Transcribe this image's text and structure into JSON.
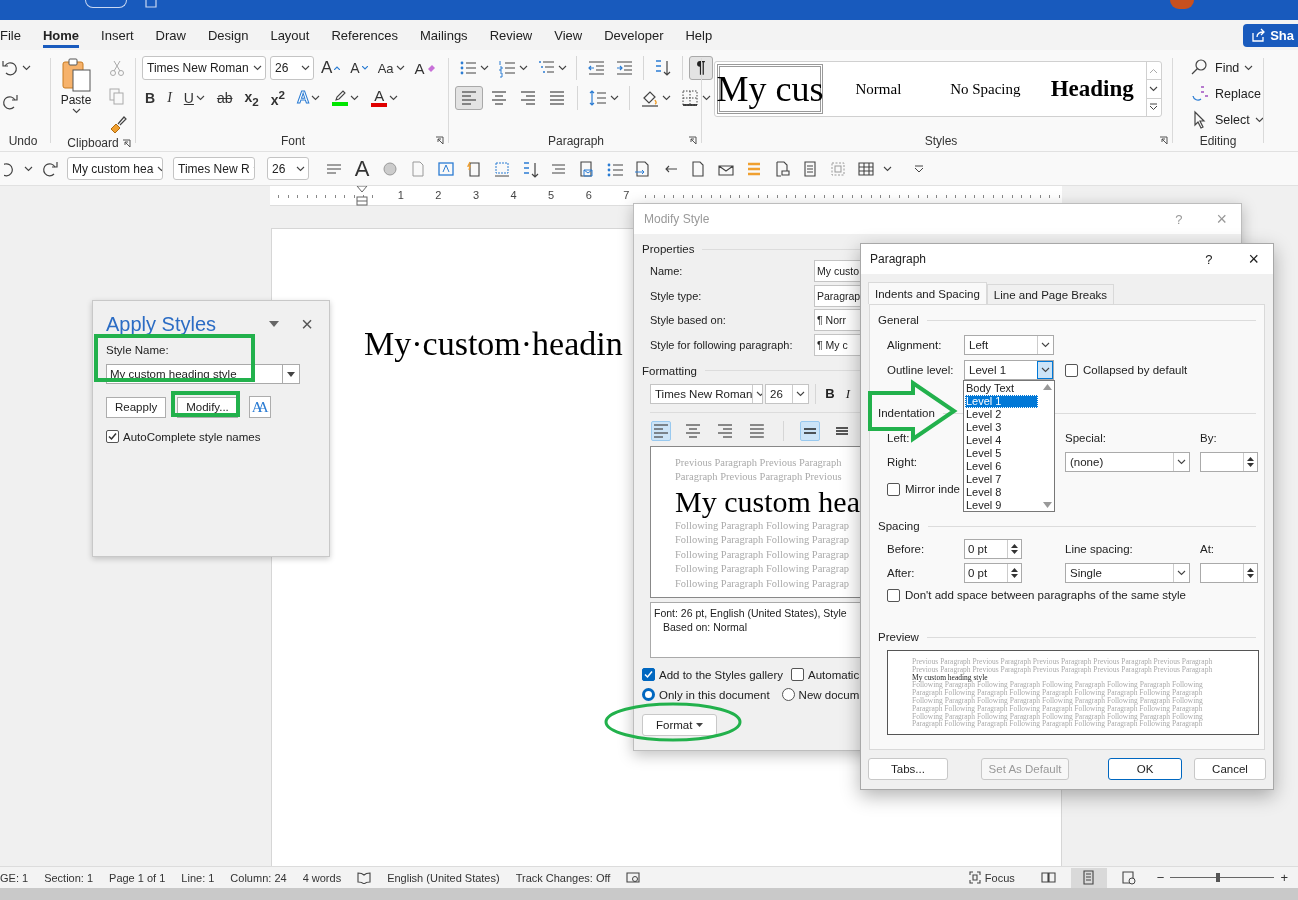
{
  "ribbon_tabs": [
    {
      "label": "File",
      "selected": false
    },
    {
      "label": "Home",
      "selected": true
    },
    {
      "label": "Insert",
      "selected": false
    },
    {
      "label": "Draw",
      "selected": false
    },
    {
      "label": "Design",
      "selected": false
    },
    {
      "label": "Layout",
      "selected": false
    },
    {
      "label": "References",
      "selected": false
    },
    {
      "label": "Mailings",
      "selected": false
    },
    {
      "label": "Review",
      "selected": false
    },
    {
      "label": "View",
      "selected": false
    },
    {
      "label": "Developer",
      "selected": false
    },
    {
      "label": "Help",
      "selected": false
    }
  ],
  "share_button": "Sha",
  "undo_group": {
    "label": "Undo"
  },
  "clipboard_group": {
    "label": "Clipboard",
    "paste": "Paste"
  },
  "font_group": {
    "label": "Font",
    "font": "Times New Roman",
    "size": "26",
    "row1": [
      {
        "kind": "grow",
        "glyph": "A"
      },
      {
        "kind": "shrink",
        "glyph": "A"
      },
      {
        "kind": "case",
        "glyph": "Aa"
      },
      {
        "kind": "clear",
        "glyph": "A"
      }
    ],
    "row2": [
      {
        "kind": "bold",
        "glyph": "B"
      },
      {
        "kind": "italic",
        "glyph": "I"
      },
      {
        "kind": "underline",
        "glyph": "U"
      },
      {
        "kind": "strike",
        "glyph": "ab"
      },
      {
        "kind": "subscript",
        "glyph": "x$_{2}$"
      },
      {
        "kind": "superscript",
        "glyph": "x$^{2}$"
      },
      {
        "kind": "effects",
        "glyph": "A"
      },
      {
        "kind": "highlight",
        "color": "#00e600"
      },
      {
        "kind": "font_color",
        "glyph": "A",
        "color": "#e00000"
      }
    ]
  },
  "paragraph_group": {
    "label": "Paragraph",
    "show_marks": {
      "glyph": "¶",
      "on": true
    },
    "alignment": [
      {
        "kind": "left",
        "selected": true
      },
      {
        "kind": "center",
        "selected": false
      },
      {
        "kind": "right",
        "selected": false
      },
      {
        "kind": "justify",
        "selected": false
      }
    ]
  },
  "styles_group": {
    "label": "Styles",
    "items": [
      {
        "label": "My cus",
        "kind": "custom",
        "selected": true
      },
      {
        "label": "Normal",
        "kind": "normal",
        "selected": false
      },
      {
        "label": "No Spacing",
        "kind": "normal",
        "selected": false
      },
      {
        "label": "Heading",
        "kind": "heading",
        "selected": false
      }
    ]
  },
  "editing_group": {
    "label": "Editing",
    "items": [
      {
        "label": "Find",
        "kind": "find"
      },
      {
        "label": "Replace",
        "kind": "replace"
      },
      {
        "label": "Select",
        "kind": "select"
      }
    ]
  },
  "quick_toolbar": {
    "style": "My custom hea",
    "font": "Times New R",
    "size": "26",
    "big_glyph": "A"
  },
  "ruler": {
    "numbers": [
      "1",
      "2",
      "3",
      "4",
      "5",
      "6",
      "7"
    ]
  },
  "document": {
    "heading": "My·custom·headin"
  },
  "apply_styles": {
    "title": "Apply Styles",
    "close": "×",
    "style_name_label": "Style Name:",
    "style_name": "My custom heading style",
    "buttons": [
      "Reapply",
      "Modify..."
    ],
    "styles_glyph": "AA",
    "autocomplete": {
      "label": "AutoComplete style names",
      "checked": true
    }
  },
  "modify_style": {
    "title": "Modify Style",
    "help": "?",
    "close": "×",
    "properties_heading": "Properties",
    "fields": [
      {
        "label": "Name:",
        "value": "My custo"
      },
      {
        "label": "Style type:",
        "value": "Paragrap"
      },
      {
        "label": "Style based on:",
        "value": "¶ Norr"
      },
      {
        "label": "Style for following paragraph:",
        "value": "¶ My c"
      }
    ],
    "formatting_heading": "Formatting",
    "font": "Times New Roman",
    "size": "26",
    "text_buttons": [
      {
        "kind": "bold",
        "glyph": "B"
      },
      {
        "kind": "italic",
        "glyph": "I"
      }
    ],
    "alignment": [
      {
        "kind": "left",
        "selected": true
      },
      {
        "kind": "center",
        "selected": false
      },
      {
        "kind": "right",
        "selected": false
      },
      {
        "kind": "justify",
        "selected": false
      }
    ],
    "spacing": [
      {
        "kind": "single",
        "selected": true
      },
      {
        "kind": "one_half",
        "selected": false
      }
    ],
    "preview": {
      "previous": [
        "Previous Paragraph Previous Paragraph",
        "Paragraph Previous Paragraph Previous"
      ],
      "heading": "My custom hea",
      "following": [
        "Following Paragraph Following Paragrap",
        "Following Paragraph Following Paragrap",
        "Following Paragraph Following Paragrap",
        "Following Paragraph Following Paragrap",
        "Following Paragraph Following Paragrap"
      ]
    },
    "description": [
      "Font: 26 pt, English (United States), Style",
      "Based on: Normal"
    ],
    "add_to_gallery": {
      "label": "Add to the Styles gallery",
      "checked": true
    },
    "auto_update": {
      "label": "Automatic",
      "checked": false
    },
    "scope": [
      {
        "label": "Only in this document",
        "selected": true
      },
      {
        "label": "New docum",
        "selected": false
      }
    ],
    "format_button": "Format"
  },
  "paragraph_dialog": {
    "title": "Paragraph",
    "help": "?",
    "close": "×",
    "tabs": [
      {
        "label": "Indents and Spacing",
        "selected": true
      },
      {
        "label": "Line and Page Breaks",
        "selected": false
      }
    ],
    "general_heading": "General",
    "alignment": {
      "label": "Alignment:",
      "value": "Left"
    },
    "outline": {
      "label": "Outline level:",
      "value": "Level 1",
      "expanded": true,
      "options": [
        {
          "label": "Body Text",
          "selected": false
        },
        {
          "label": "Level 1",
          "selected": true
        },
        {
          "label": "Level 2",
          "selected": false
        },
        {
          "label": "Level 3",
          "selected": false
        },
        {
          "label": "Level 4",
          "selected": false
        },
        {
          "label": "Level 5",
          "selected": false
        },
        {
          "label": "Level 6",
          "selected": false
        },
        {
          "label": "Level 7",
          "selected": false
        },
        {
          "label": "Level 8",
          "selected": false
        },
        {
          "label": "Level 9",
          "selected": false
        }
      ]
    },
    "collapsed": {
      "label": "Collapsed by default",
      "checked": false
    },
    "indentation_heading": "Indentation",
    "left_label": "Left:",
    "right_label": "Right:",
    "mirror": {
      "label": "Mirror inde",
      "checked": false
    },
    "special": {
      "label": "Special:",
      "value": "(none)"
    },
    "by_label": "By:",
    "spacing_heading": "Spacing",
    "before": {
      "label": "Before:",
      "value": "0 pt"
    },
    "after": {
      "label": "After:",
      "value": "0 pt"
    },
    "line_spacing": {
      "label": "Line spacing:",
      "value": "Single"
    },
    "at_label": "At:",
    "dont_add_space": {
      "label": "Don't add space between paragraphs of the same style",
      "checked": false
    },
    "preview_heading": "Preview",
    "preview": {
      "previous": [
        "Previous Paragraph Previous Paragraph Previous Paragraph Previous Paragraph Previous Paragraph",
        "Previous Paragraph Previous Paragraph Previous Paragraph Previous Paragraph Previous Paragraph"
      ],
      "heading": "My custom heading style",
      "following": [
        "Following Paragraph Following Paragraph Following Paragraph Following Paragraph Following",
        "Paragraph Following Paragraph Following Paragraph Following Paragraph Following Paragraph",
        "Following Paragraph Following Paragraph Following Paragraph Following Paragraph Following",
        "Paragraph Following Paragraph Following Paragraph Following Paragraph Following Paragraph",
        "Following Paragraph Following Paragraph Following Paragraph Following Paragraph Following",
        "Paragraph Following Paragraph Following Paragraph Following Paragraph Following Paragraph"
      ]
    },
    "buttons": [
      {
        "label": "Tabs...",
        "kind": "normal"
      },
      {
        "label": "Set As Default",
        "kind": "disabled"
      },
      {
        "label": "OK",
        "kind": "default"
      },
      {
        "label": "Cancel",
        "kind": "normal"
      }
    ]
  },
  "status_bar": {
    "items": [
      "GE: 1",
      "Section: 1",
      "Page 1 of 1",
      "Line: 1",
      "Column: 24",
      "4 words"
    ],
    "language": "English (United States)",
    "track_changes": "Track Changes: Off",
    "focus": "Focus",
    "views": [
      {
        "kind": "read",
        "selected": false
      },
      {
        "kind": "print",
        "selected": true
      },
      {
        "kind": "web",
        "selected": false
      }
    ],
    "zoom": {
      "minus": "−",
      "plus": "+",
      "level": 0.46
    }
  }
}
